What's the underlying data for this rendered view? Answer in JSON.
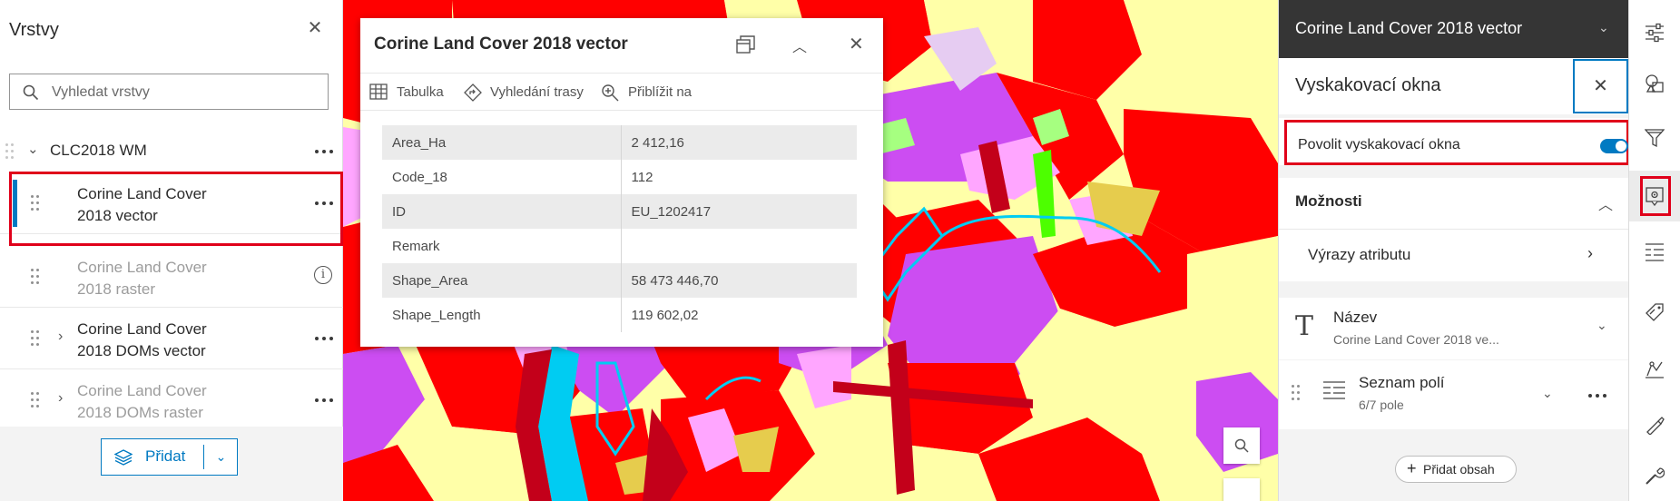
{
  "left_panel": {
    "title": "Vrstvy",
    "search_placeholder": "Vyhledat vrstvy",
    "group_label": "CLC2018 WM",
    "layers": [
      {
        "label": "Corine Land Cover\n2018 vector",
        "selected": true
      },
      {
        "label": "Corine Land Cover\n2018 raster",
        "dimmed": true
      },
      {
        "label": "Corine Land Cover\n2018 DOMs vector"
      },
      {
        "label": "Corine Land Cover\n2018 DOMs raster",
        "dimmed": true
      }
    ],
    "add_label": "Přidat"
  },
  "popup": {
    "title": "Corine Land Cover 2018 vector",
    "actions": [
      "Tabulka",
      "Vyhledání trasy",
      "Přiblížit na"
    ],
    "rows": [
      {
        "key": "Area_Ha",
        "value": "2 412,16"
      },
      {
        "key": "Code_18",
        "value": "112"
      },
      {
        "key": "ID",
        "value": "EU_1202417"
      },
      {
        "key": "Remark",
        "value": ""
      },
      {
        "key": "Shape_Area",
        "value": "58 473 446,70"
      },
      {
        "key": "Shape_Length",
        "value": "119 602,02"
      }
    ]
  },
  "right_panel": {
    "header_title": "Corine Land Cover 2018 vector",
    "sub_title": "Vyskakovací okna",
    "toggle_label": "Povolit vyskakovací okna",
    "toggle_on": true,
    "options_label": "Možnosti",
    "attribute_expressions": "Výrazy atributu",
    "title_card": {
      "label": "Název",
      "sub": "Corine Land Cover 2018 ve..."
    },
    "fields_card": {
      "label": "Seznam polí",
      "sub": "6/7 pole"
    },
    "add_content": "Přidat obsah"
  },
  "colors": {
    "accent": "#007ac2",
    "highlight_border": "#e0001a",
    "header_dark": "#353535",
    "land_red": "#ff0000",
    "land_yellow": "#ffffa8",
    "land_violet": "#cc4df2",
    "land_pink": "#ffa6ff",
    "water": "#00ccf2"
  },
  "icons": [
    "search-icon",
    "close-icon",
    "grip-icon",
    "more-icon",
    "info-icon",
    "layers-icon",
    "table-icon",
    "route-icon",
    "zoom-to-icon",
    "dock-icon",
    "chevron-icon",
    "text-icon",
    "fields-list-icon",
    "plus-icon",
    "properties-icon",
    "styles-icon",
    "filter-icon",
    "popups-icon",
    "labels-icon",
    "sketch-icon",
    "analysis-icon",
    "tools-icon"
  ]
}
